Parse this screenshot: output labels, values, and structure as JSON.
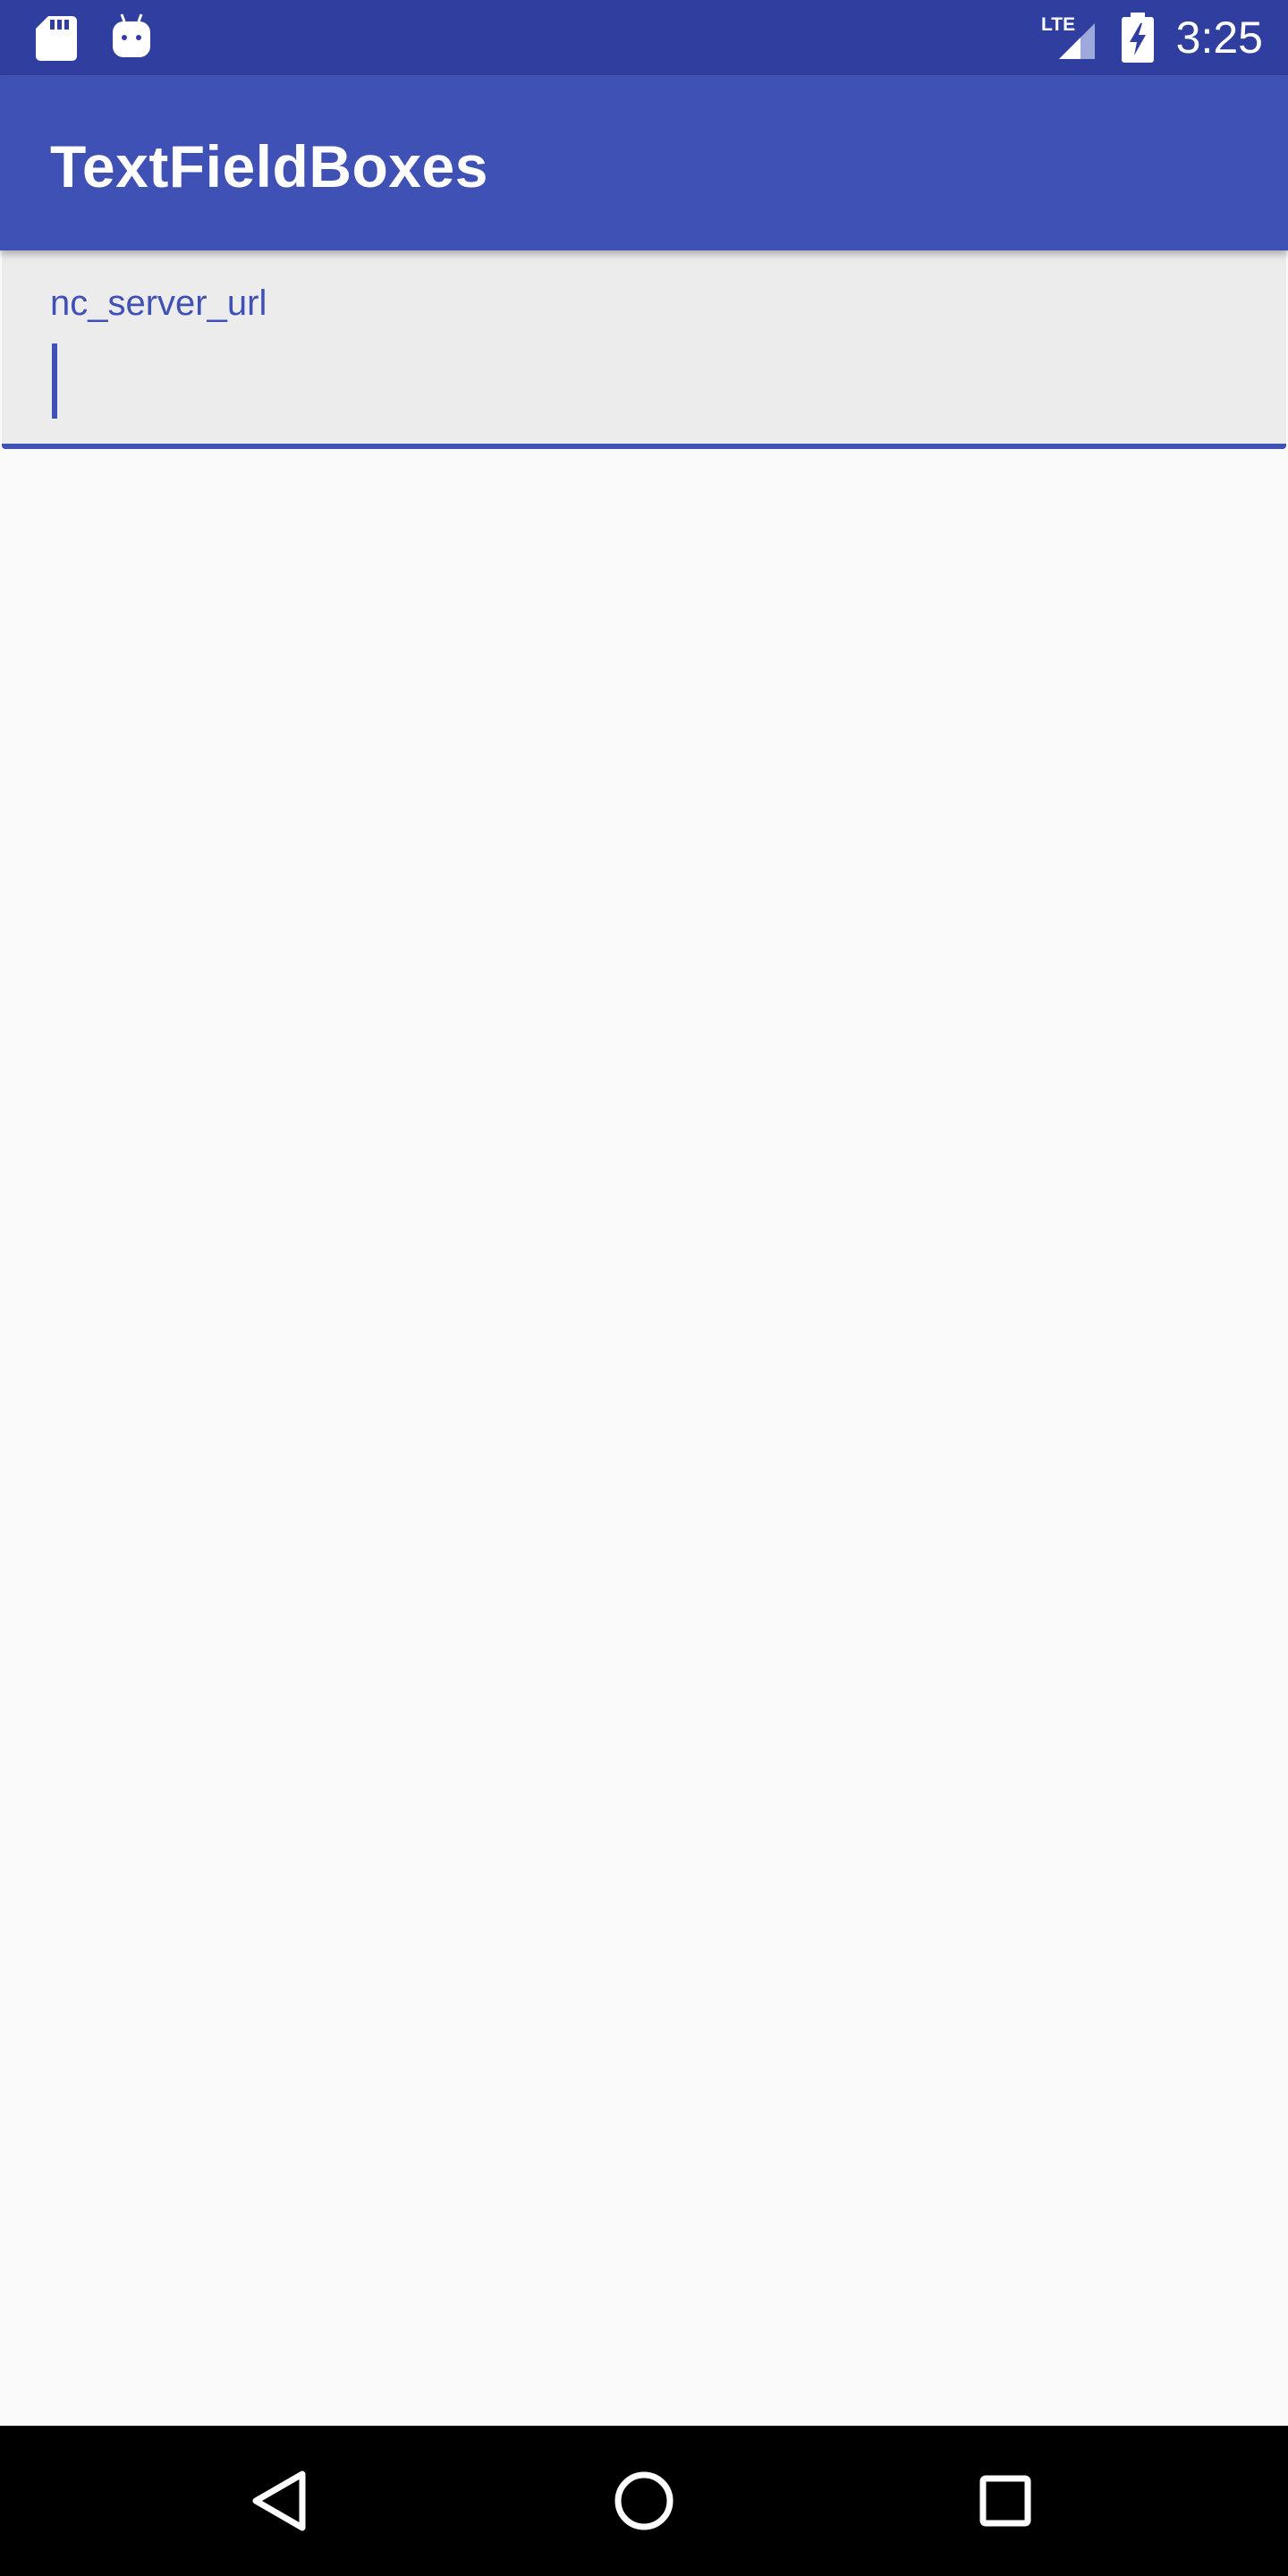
{
  "status_bar": {
    "time": "3:25",
    "network_label": "LTE",
    "icons": [
      "sd-card-icon",
      "android-debug-icon",
      "lte-signal-icon",
      "battery-charging-icon"
    ]
  },
  "app_bar": {
    "title": "TextFieldBoxes"
  },
  "text_field": {
    "label": "nc_server_url",
    "value": ""
  },
  "nav_bar": {
    "icons": [
      "back-icon",
      "home-icon",
      "recents-icon"
    ]
  },
  "colors": {
    "status_bar": "#303f9f",
    "primary": "#3f51b5",
    "field_background": "#ececed",
    "page_background": "#fafafa",
    "nav_bar": "#000000"
  }
}
